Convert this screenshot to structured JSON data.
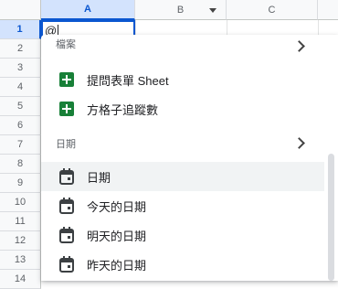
{
  "sheet": {
    "columns": [
      "A",
      "B",
      "C"
    ],
    "rows": [
      "1",
      "2",
      "3",
      "4",
      "5",
      "6",
      "7",
      "8",
      "9",
      "10",
      "11",
      "12",
      "13",
      "14"
    ],
    "active_cell_value": "@"
  },
  "menu": {
    "sections": [
      {
        "label": "檔案"
      },
      {
        "label": "日期"
      }
    ],
    "items": [
      {
        "label": "提問表單 Sheet",
        "icon": "sheets-icon"
      },
      {
        "label": "方格子追蹤數",
        "icon": "sheets-icon"
      },
      {
        "label": "日期",
        "icon": "calendar-icon"
      },
      {
        "label": "今天的日期",
        "icon": "calendar-icon"
      },
      {
        "label": "明天的日期",
        "icon": "calendar-icon"
      },
      {
        "label": "昨天的日期",
        "icon": "calendar-icon"
      }
    ]
  },
  "colors": {
    "accent": "#0b57d0",
    "sheets_green": "#188038"
  }
}
